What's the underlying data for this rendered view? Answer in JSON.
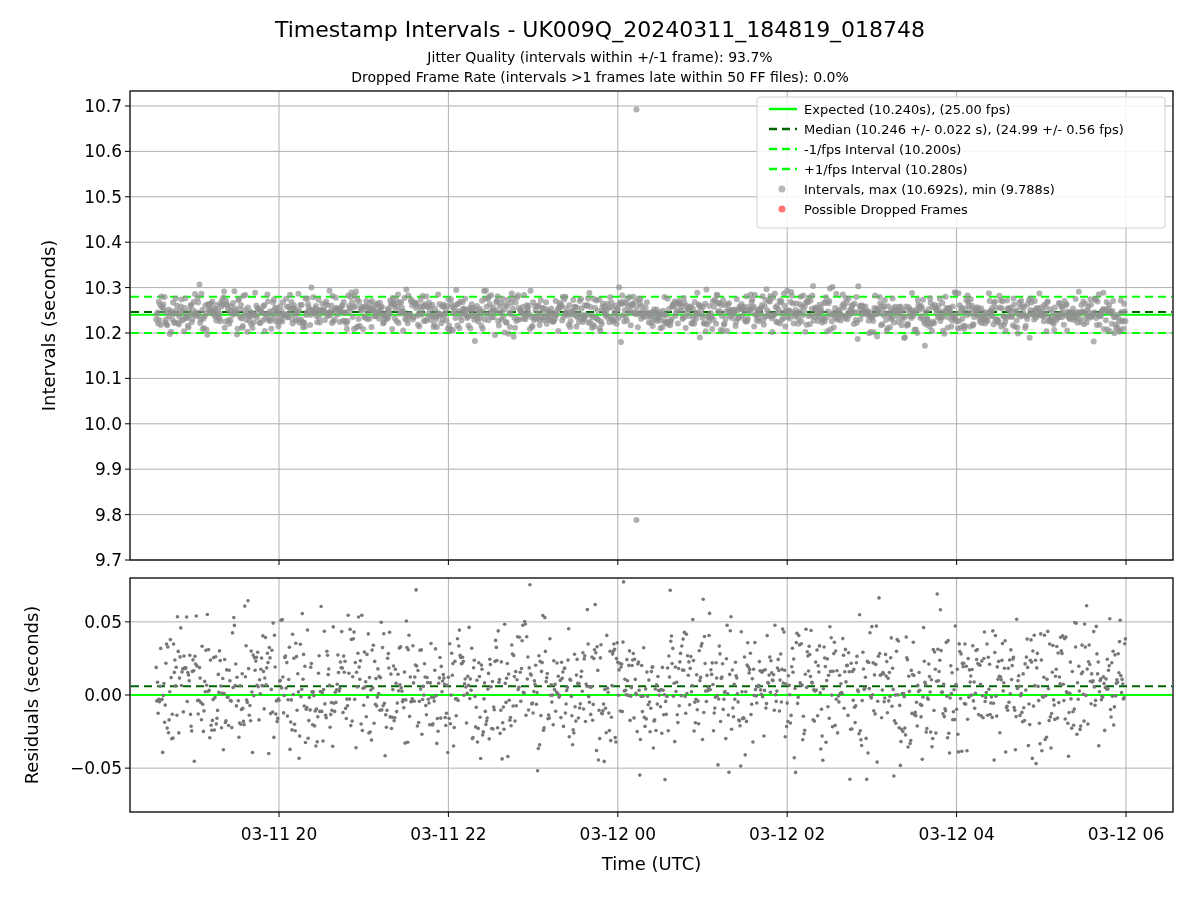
{
  "figure": {
    "title": "Timestamp Intervals - UK009Q_20240311_184819_018748",
    "subtitles": [
      "Jitter Quality (intervals within +/-1 frame): 93.7%",
      "Dropped Frame Rate (intervals >1 frames late within 50 FF files): 0.0%"
    ]
  },
  "intervals_panel": {
    "chart_data": {
      "type": "scatter",
      "ylabel": "Intervals (seconds)",
      "ylim": [
        9.7,
        10.733
      ],
      "grid": true,
      "categories": [
        null,
        null,
        null,
        null,
        null,
        null
      ],
      "yticks": [
        {
          "value": 9.7,
          "label": "9.7"
        },
        {
          "value": 9.8,
          "label": "9.8"
        },
        {
          "value": 9.9,
          "label": "9.9"
        },
        {
          "value": 10.0,
          "label": "10.0"
        },
        {
          "value": 10.1,
          "label": "10.1"
        },
        {
          "value": 10.2,
          "label": "10.2"
        },
        {
          "value": 10.3,
          "label": "10.3"
        },
        {
          "value": 10.4,
          "label": "10.4"
        },
        {
          "value": 10.5,
          "label": "10.5"
        },
        {
          "value": 10.6,
          "label": "10.6"
        },
        {
          "value": 10.7,
          "label": "10.7"
        }
      ],
      "ref_lines": [
        {
          "axis": "y",
          "value": 10.24,
          "label": "Expected (10.240s), (25.00 fps)",
          "color": "#00ff00"
        },
        {
          "axis": "y",
          "value": 10.246,
          "label": "Median (10.246 +/- 0.022 s), (24.99 +/- 0.56 fps)",
          "color": "#006400"
        },
        {
          "axis": "y",
          "value": 10.2,
          "label": "-1/fps Interval (10.200s)",
          "color": "#00ff00"
        },
        {
          "axis": "y",
          "value": 10.28,
          "label": "+1/fps Interval (10.280s)",
          "color": "#00ff00"
        }
      ],
      "series": [
        {
          "name": "Intervals, max (10.692s), min (9.788s)",
          "color": "#808080",
          "values": [
            null,
            null,
            null,
            null,
            null,
            null
          ]
        },
        {
          "name": "Possible Dropped Frames",
          "color": "#ff0000",
          "values": [
            null,
            null,
            null,
            null,
            null,
            null
          ]
        }
      ]
    }
  },
  "residuals_panel": {
    "chart_data": {
      "type": "scatter",
      "xlabel": "Time (UTC)",
      "ylabel": "Residuals (seconds)",
      "ylim": [
        -0.08,
        0.08
      ],
      "grid": true,
      "categories": [
        "03-11 20",
        "03-11 22",
        "03-12 00",
        "03-12 02",
        "03-12 04",
        "03-12 06"
      ],
      "yticks": [
        {
          "value": -0.05,
          "label": "−0.05"
        },
        {
          "value": 0,
          "label": "0.00"
        },
        {
          "value": 0.05,
          "label": "0.05"
        }
      ],
      "ref_lines": [
        {
          "axis": "y",
          "value": 0,
          "color": "#00ff00"
        },
        {
          "axis": "y",
          "value": 0.006,
          "color": "#006400"
        }
      ]
    }
  }
}
